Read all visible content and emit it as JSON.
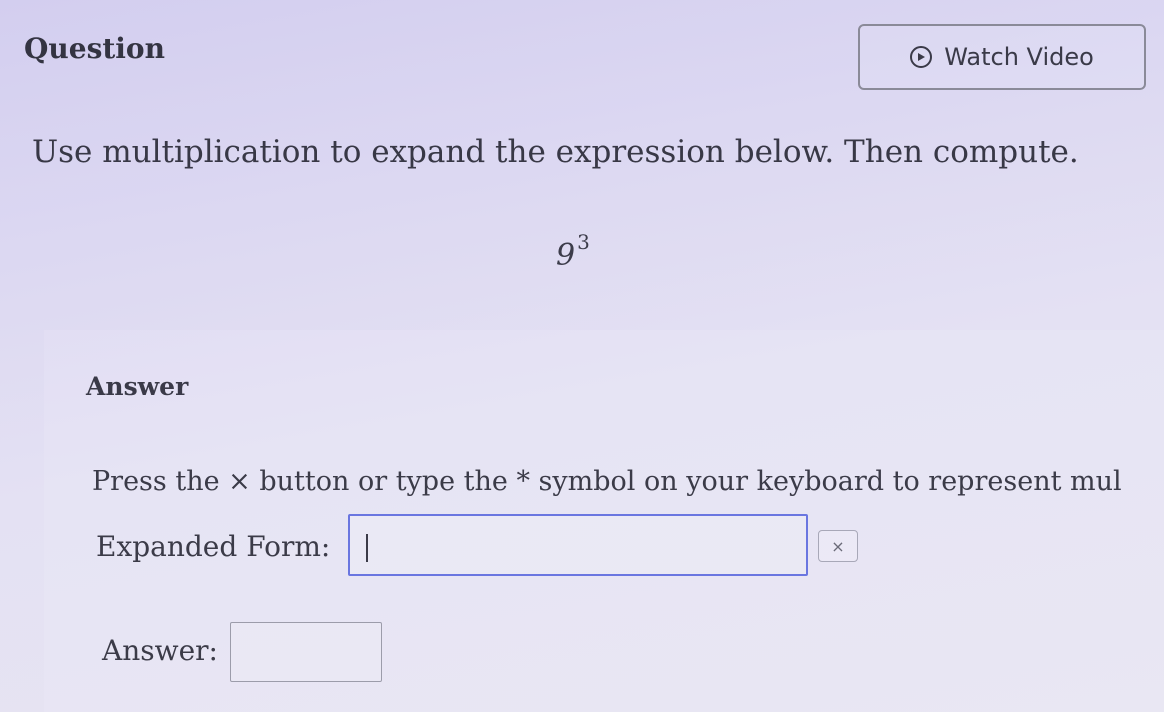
{
  "header": {
    "title": "Question",
    "watch_video_label": "Watch Video",
    "watch_video_icon": "play-circle-icon"
  },
  "question": {
    "instruction": "Use multiplication to expand the expression below. Then compute.",
    "expression_base": "9",
    "expression_exponent": "3"
  },
  "answer": {
    "heading": "Answer",
    "multiplication_hint": "Press the × button or type the * symbol on your keyboard to represent mul",
    "expanded_form_label": "Expanded Form:",
    "expanded_form_value": "",
    "times_button_label": "×",
    "answer_label": "Answer:",
    "answer_value": ""
  },
  "colors": {
    "background": "#dcd8f2",
    "active_input_border": "#6a76e0",
    "text": "#3b3b48"
  }
}
